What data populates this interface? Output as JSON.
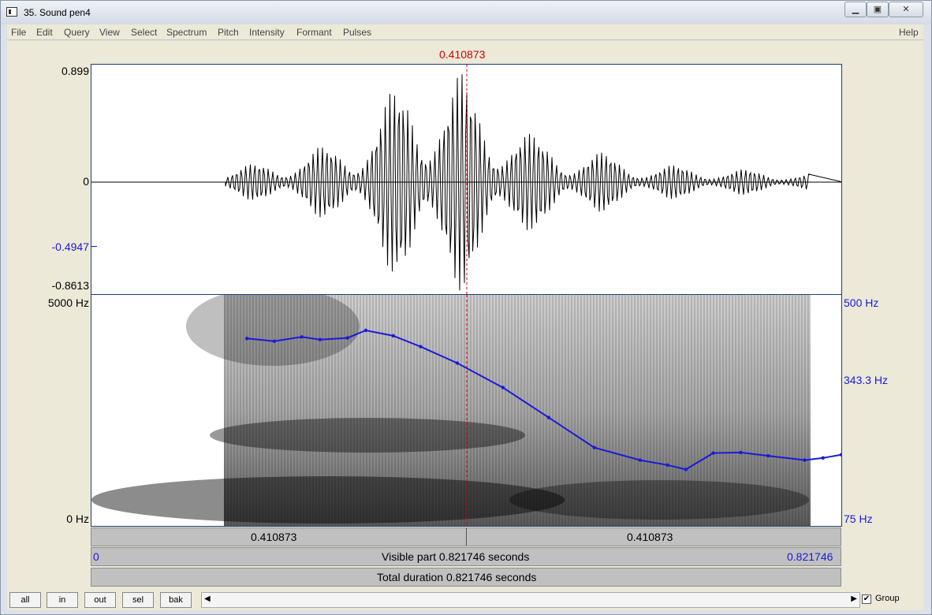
{
  "window": {
    "title": "35. Sound pen4",
    "controls": [
      "minimize-icon",
      "restore-icon",
      "close-icon"
    ]
  },
  "menu": {
    "items": [
      "File",
      "Edit",
      "Query",
      "View",
      "Select",
      "Spectrum",
      "Pitch",
      "Intensity",
      "Formant",
      "Pulses"
    ],
    "help": "Help"
  },
  "cursor": {
    "time_label": "0.410873"
  },
  "waveform": {
    "y_max_label": "0.899",
    "y_zero_label": "0",
    "y_marker_label": "-0.4947",
    "y_min_label": "-0.8613"
  },
  "spectrogram": {
    "freq_top_label": "5000 Hz",
    "freq_bottom_label": "0 Hz",
    "pitch_top_label": "500 Hz",
    "pitch_mid_label": "343.3 Hz",
    "pitch_bottom_label": "75 Hz"
  },
  "time_bars": {
    "left_segment": "0.410873",
    "right_segment": "0.410873",
    "visible_start": "0",
    "visible_label": "Visible part 0.821746 seconds",
    "visible_end": "0.821746",
    "total_label": "Total duration 0.821746 seconds"
  },
  "zoom_buttons": [
    "all",
    "in",
    "out",
    "sel",
    "bak"
  ],
  "group": {
    "label": "Group",
    "checked": true,
    "check_mark": "✔"
  },
  "colors": {
    "cursor": "#d40000",
    "pitch_line": "#1a1ad8",
    "axis_blue": "#1a1ad8",
    "waveform": "#000000"
  },
  "chart_data": {
    "type": "line",
    "series": [
      {
        "name": "",
        "unit": "Hz",
        "note": "pitch contour values in Hz, read against 75–500 Hz pitch axis",
        "x": [
          0.17,
          0.2,
          0.23,
          0.25,
          0.28,
          0.3,
          0.33,
          0.36,
          0.4,
          0.45,
          0.5,
          0.55,
          0.6,
          0.63,
          0.65,
          0.68,
          0.71,
          0.74,
          0.78,
          0.8,
          0.82
        ],
        "y": [
          420,
          415,
          423,
          418,
          421,
          435,
          425,
          405,
          375,
          330,
          275,
          220,
          197,
          188,
          180,
          210,
          211,
          205,
          197,
          201,
          207
        ]
      }
    ],
    "xlim": [
      0,
      0.821746
    ],
    "ylim": [
      75,
      500
    ]
  }
}
